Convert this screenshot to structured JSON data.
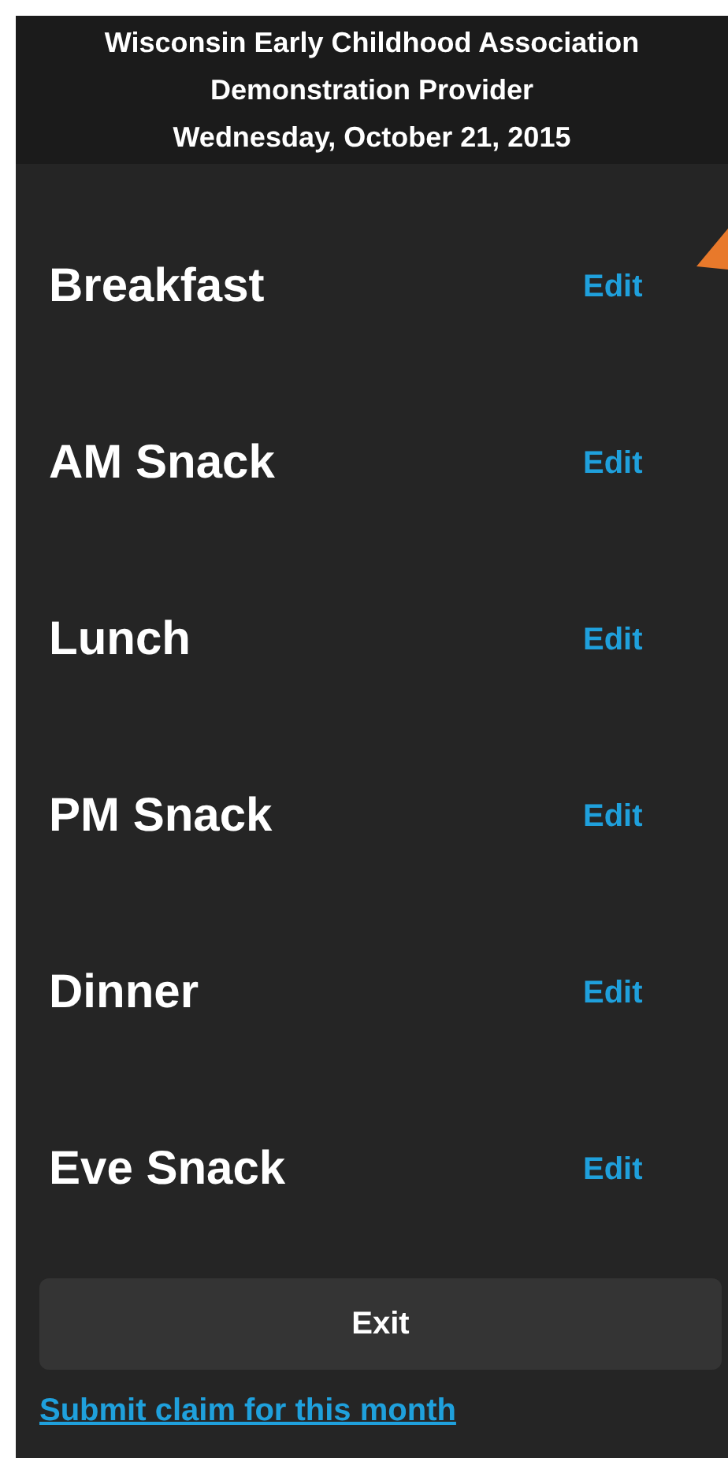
{
  "header": {
    "lines": [
      "Wisconsin Early Childhood Association",
      "Demonstration Provider",
      "Wednesday, October 21, 2015"
    ]
  },
  "meals": [
    {
      "name": "Breakfast",
      "action": "Edit"
    },
    {
      "name": "AM Snack",
      "action": "Edit"
    },
    {
      "name": "Lunch",
      "action": "Edit"
    },
    {
      "name": "PM Snack",
      "action": "Edit"
    },
    {
      "name": "Dinner",
      "action": "Edit"
    },
    {
      "name": "Eve Snack",
      "action": "Edit"
    }
  ],
  "exit_button": "Exit",
  "submit_link": "Submit claim for this month"
}
